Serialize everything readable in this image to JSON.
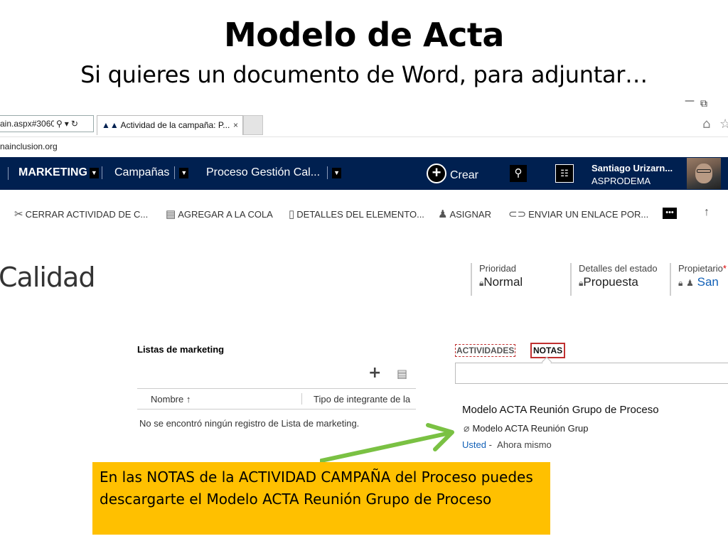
{
  "slide": {
    "title": "Modelo de Acta",
    "subtitle": "Si quieres un documento de Word, para adjuntar…"
  },
  "browser": {
    "url_fragment": "ain.aspx#30600",
    "tab_title": "Actividad de la campaña: P...",
    "tab_close": "×",
    "favorites_text": "nainclusion.org",
    "window_buttons": {
      "minimize": "—",
      "restore": "⧉"
    },
    "icons": {
      "search": "search-icon",
      "dropdown": "chevron-down-icon",
      "refresh": "refresh-icon",
      "home": "home-icon",
      "favorite": "star-icon"
    }
  },
  "navbar": {
    "background": "#002050",
    "items": [
      {
        "label": "MARKETING"
      },
      {
        "label": "Campañas"
      },
      {
        "label": "Proceso Gestión Cal..."
      }
    ],
    "crear_label": "Crear",
    "user_name": "Santiago Urizarn...",
    "user_org": "ASPRODEMA"
  },
  "commands": [
    {
      "label": "CERRAR ACTIVIDAD DE C...",
      "icon": "close-activity-icon"
    },
    {
      "label": "AGREGAR A LA COLA",
      "icon": "queue-icon"
    },
    {
      "label": "DETALLES DEL ELEMENTO...",
      "icon": "document-icon"
    },
    {
      "label": "ASIGNAR",
      "icon": "assign-icon"
    },
    {
      "label": "ENVIAR UN ENLACE POR...",
      "icon": "link-icon"
    }
  ],
  "record": {
    "title": "Calidad",
    "fields": [
      {
        "label": "Prioridad",
        "value": "Normal"
      },
      {
        "label": "Detalles del estado",
        "value": "Propuesta"
      },
      {
        "label": "Propietario",
        "required_mark": "*",
        "value": "San"
      }
    ]
  },
  "marketing_lists": {
    "title": "Listas de marketing",
    "columns": [
      "Nombre ↑",
      "Tipo de integrante de la"
    ],
    "empty_message": "No se encontró ningún registro de Lista de marketing."
  },
  "notes": {
    "tabs": [
      "ACTIVIDADES",
      "NOTAS"
    ],
    "note_title": "Modelo ACTA Reunión Grupo de Proceso",
    "attachment": "Modelo ACTA Reunión Grup",
    "author": "Usted",
    "separator": "-",
    "time": "Ahora mismo"
  },
  "callout": {
    "text": "En las NOTAS de la ACTIVIDAD CAMPAÑA del Proceso puedes descargarte el Modelo ACTA Reunión Grupo de Proceso",
    "background": "#ffc000"
  },
  "colors": {
    "accent_link": "#1160b7",
    "arrow": "#7ac143",
    "highlight_border": "#c03030"
  }
}
